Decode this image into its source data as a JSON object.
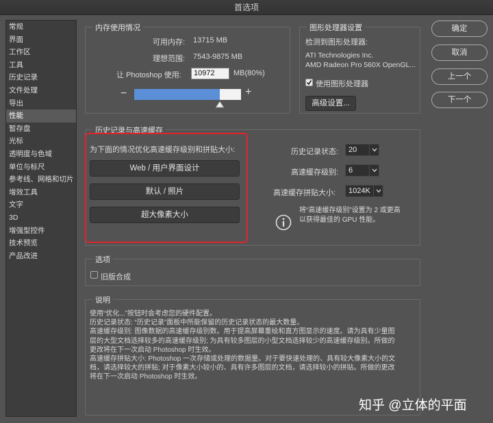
{
  "window": {
    "title": "首选项"
  },
  "sidebar": {
    "items": [
      {
        "label": "常规"
      },
      {
        "label": "界面"
      },
      {
        "label": "工作区"
      },
      {
        "label": "工具"
      },
      {
        "label": "历史记录"
      },
      {
        "label": "文件处理"
      },
      {
        "label": "导出"
      },
      {
        "label": "性能"
      },
      {
        "label": "暂存盘"
      },
      {
        "label": "光标"
      },
      {
        "label": "透明度与色域"
      },
      {
        "label": "单位与标尺"
      },
      {
        "label": "参考线、网格和切片"
      },
      {
        "label": "增效工具"
      },
      {
        "label": "文字"
      },
      {
        "label": "3D"
      },
      {
        "label": "增强型控件"
      },
      {
        "label": "技术预览"
      },
      {
        "label": "产品改进"
      }
    ],
    "selected": "性能"
  },
  "memory": {
    "title": "内存使用情况",
    "available_label": "可用内存:",
    "available_value": "13715 MB",
    "ideal_label": "理想范围:",
    "ideal_value": "7543-9875 MB",
    "let_label": "让 Photoshop 使用:",
    "let_value": "10972",
    "unit": "MB(80%)",
    "minus": "−",
    "plus": "+",
    "slider_fraction": 0.8
  },
  "gpu": {
    "title": "图形处理器设置",
    "detected_label": "检测到图形处理器:",
    "vendor": "ATI Technologies Inc.",
    "model": "AMD Radeon Pro 560X OpenGL...",
    "use_gpu_label": "使用图形处理器",
    "use_gpu_checked": true,
    "advanced_button": "高级设置..."
  },
  "buttons": {
    "ok": "确定",
    "cancel": "取消",
    "prev": "上一个",
    "next": "下一个"
  },
  "history_cache": {
    "title": "历史记录与高速缓存",
    "optimize_label": "为下面的情况优化高速缓存级别和拼贴大小:",
    "opt_web": "Web / 用户界面设计",
    "opt_default": "默认 / 照片",
    "opt_huge": "超大像素大小",
    "history_states_label": "历史记录状态:",
    "history_states_value": "20",
    "cache_levels_label": "高速缓存级别:",
    "cache_levels_value": "6",
    "tile_size_label": "高速缓存拼贴大小:",
    "tile_size_value": "1024K",
    "info_line1": "将“高速缓存级别”设置为 2 或更高",
    "info_line2": "以获得最佳的 GPU 性能。"
  },
  "options": {
    "title": "选项",
    "legacy_label": "旧版合成",
    "legacy_checked": false
  },
  "description": {
    "title": "说明",
    "lines": [
      "使用“优化...”按钮时会考虑您的硬件配置。",
      "历史记录状态: “历史记录”面板中所能保留的历史记录状态的最大数量。",
      "高速缓存级别: 图像数据的高速缓存级别数。用于提高屏幕重绘和直方图显示的速度。请为具有少量图",
      "层的大型文档选择较多的高速缓存级别; 为具有较多图层的小型文档选择较少的高速缓存级别。所做的",
      "更改将在下一次启动 Photoshop 时生效。",
      "高速缓存拼贴大小: Photoshop 一次存储或处理的数据量。对于要快速处理的、具有较大像素大小的文",
      "档，请选择较大的拼贴; 对于像素大小较小的、具有许多图层的文档，请选择较小的拼贴。所做的更改",
      "将在下一次启动 Photoshop 时生效。"
    ]
  },
  "watermark": "知乎 @立体的平面",
  "colors": {
    "panel_bg": "#535353",
    "slider_fill": "#5b8fd8",
    "highlight_border": "#e0242d"
  }
}
